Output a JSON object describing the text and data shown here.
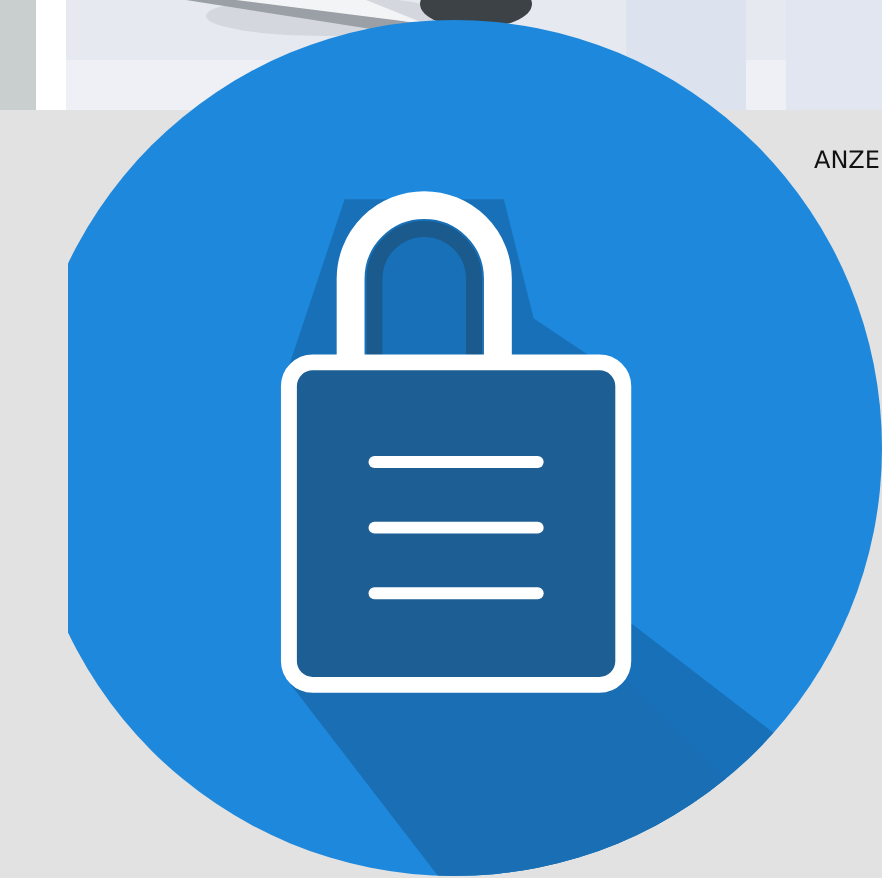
{
  "side_label": "ANZE"
}
